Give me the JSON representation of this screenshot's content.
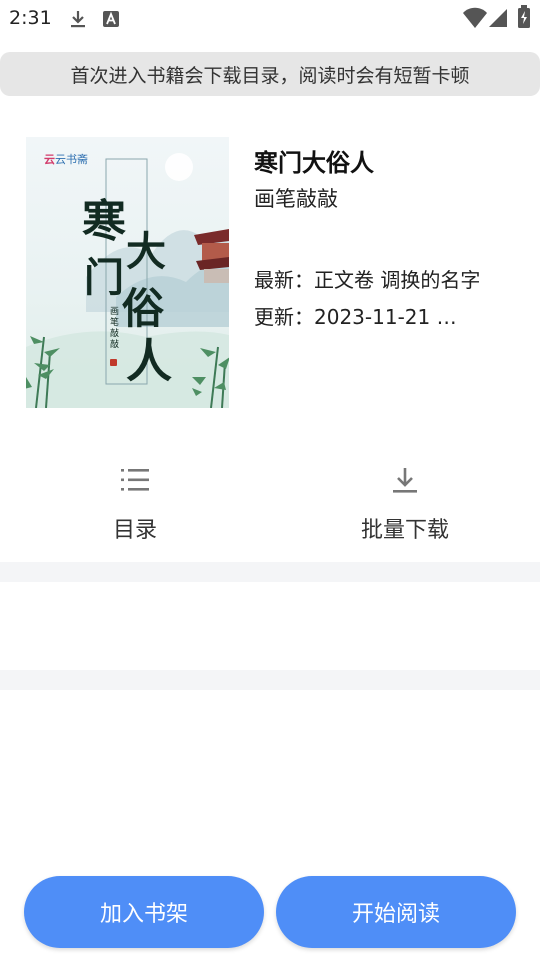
{
  "status_bar": {
    "time": "2:31",
    "icons": [
      "download-icon",
      "a-icon",
      "wifi-icon",
      "signal-icon",
      "battery-icon"
    ]
  },
  "notice": "首次进入书籍会下载目录，阅读时会有短暂卡顿",
  "book": {
    "title": "寒门大俗人",
    "author": "画笔敲敲",
    "latest": "最新：正文卷 调换的名字",
    "updated": "更新：2023-11-21 …",
    "cover": {
      "publisher": "云书斋",
      "art_title": [
        "寒",
        "门",
        "大",
        "俗",
        "人"
      ],
      "art_author": "画笔敲敲"
    }
  },
  "actions": [
    {
      "label": "目录",
      "icon": "list-icon"
    },
    {
      "label": "批量下载",
      "icon": "download-icon"
    }
  ],
  "buttons": {
    "add_to_shelf": "加入书架",
    "start_reading": "开始阅读"
  },
  "colors": {
    "primary": "#4f8ef7",
    "notice_bg": "#e6e6e6",
    "band_bg": "#f4f5f7"
  }
}
